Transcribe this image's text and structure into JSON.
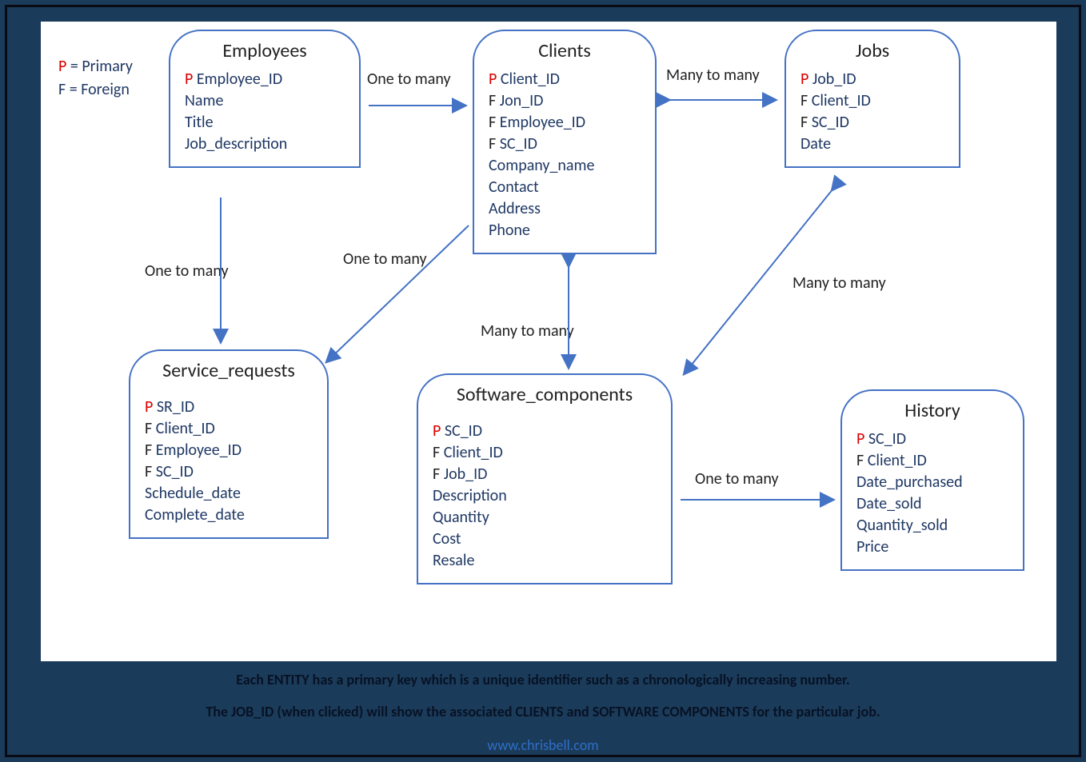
{
  "legend": {
    "p_label": "P",
    "p_text": " = Primary",
    "f_label": "F",
    "f_text": " = Foreign"
  },
  "entities": {
    "employees": {
      "title": "Employees",
      "attrs": [
        {
          "key": "P",
          "name": "Employee_ID"
        },
        {
          "key": "",
          "name": "Name"
        },
        {
          "key": "",
          "name": "Title"
        },
        {
          "key": "",
          "name": "Job_description"
        }
      ]
    },
    "clients": {
      "title": "Clients",
      "attrs": [
        {
          "key": "P",
          "name": "Client_ID"
        },
        {
          "key": "F",
          "name": "Jon_ID"
        },
        {
          "key": "F",
          "name": "Employee_ID"
        },
        {
          "key": "F",
          "name": "SC_ID"
        },
        {
          "key": "",
          "name": "Company_name"
        },
        {
          "key": "",
          "name": "Contact"
        },
        {
          "key": "",
          "name": "Address"
        },
        {
          "key": "",
          "name": "Phone"
        }
      ]
    },
    "jobs": {
      "title": "Jobs",
      "attrs": [
        {
          "key": "P",
          "name": "Job_ID"
        },
        {
          "key": "F",
          "name": "Client_ID"
        },
        {
          "key": "F",
          "name": "SC_ID"
        },
        {
          "key": "",
          "name": "Date"
        }
      ]
    },
    "service_requests": {
      "title": "Service_requests",
      "attrs": [
        {
          "key": "P",
          "name": "SR_ID"
        },
        {
          "key": "F",
          "name": "Client_ID"
        },
        {
          "key": "F",
          "name": "Employee_ID"
        },
        {
          "key": "F",
          "name": "SC_ID"
        },
        {
          "key": "",
          "name": "Schedule_date"
        },
        {
          "key": "",
          "name": "Complete_date"
        }
      ]
    },
    "software_components": {
      "title": "Software_components",
      "attrs": [
        {
          "key": "P",
          "name": "SC_ID"
        },
        {
          "key": "F",
          "name": "Client_ID"
        },
        {
          "key": "F",
          "name": "Job_ID"
        },
        {
          "key": "",
          "name": "Description"
        },
        {
          "key": "",
          "name": "Quantity"
        },
        {
          "key": "",
          "name": "Cost"
        },
        {
          "key": "",
          "name": "Resale"
        }
      ]
    },
    "history": {
      "title": "History",
      "attrs": [
        {
          "key": "P",
          "name": "SC_ID"
        },
        {
          "key": "F",
          "name": "Client_ID"
        },
        {
          "key": "",
          "name": "Date_purchased"
        },
        {
          "key": "",
          "name": "Date_sold"
        },
        {
          "key": "",
          "name": "Quantity_sold"
        },
        {
          "key": "",
          "name": "Price"
        }
      ]
    }
  },
  "relations": {
    "emp_clients": "One to many",
    "clients_jobs": "Many to many",
    "emp_sr": "One to many",
    "clients_sr": "One to many",
    "clients_sc": "Many to many",
    "jobs_sc": "Many to many",
    "sc_history": "One to many"
  },
  "captions": {
    "line1": "Each ENTITY has a primary key which is a unique identifier such as a chronologically increasing number.",
    "line2": "The JOB_ID (when clicked) will show the associated CLIENTS and SOFTWARE COMPONENTS for the particular job.",
    "link": "www.chrisbell.com"
  },
  "colors": {
    "border": "#4472c4",
    "arrow": "#4472c4",
    "primary": "#d90000",
    "text": "#1f3864"
  }
}
